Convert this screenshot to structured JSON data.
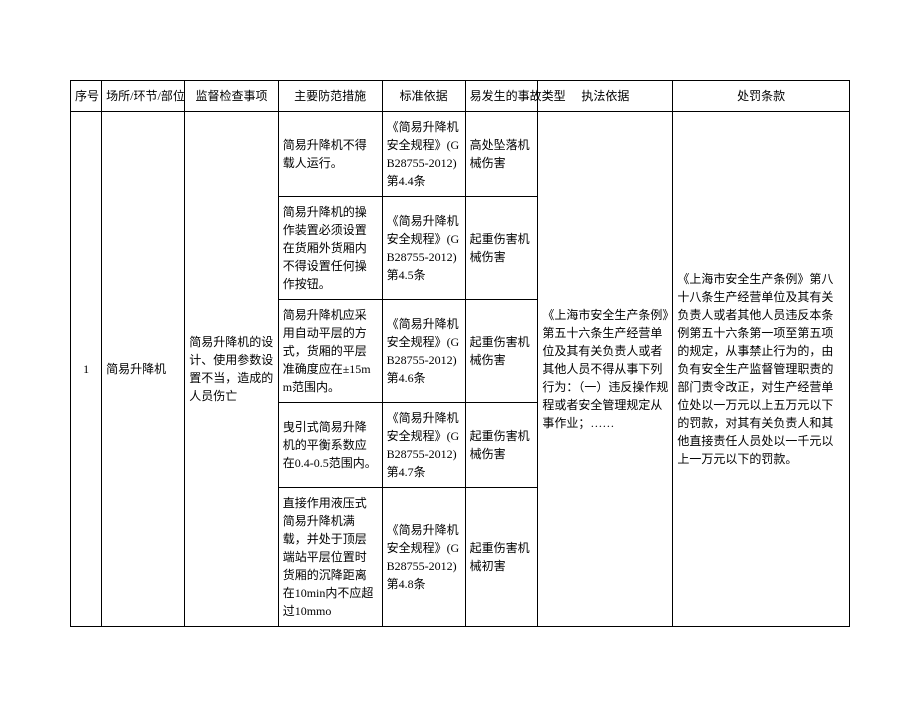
{
  "headers": {
    "seq": "序号",
    "place": "场所/环节/部位",
    "inspect": "监督检查事项",
    "measure": "主要防范措施",
    "standard": "标准依据",
    "accident": "易发生的事故类型",
    "enforce": "执法依据",
    "penalty": "处罚条款"
  },
  "row": {
    "seq": "1",
    "place": "简易升降机",
    "inspect": "简易升降机的设计、使用参数设置不当，造成的人员伤亡",
    "enforce": "《上海市安全生产条例》第五十六条生产经营单位及其有关负责人或者其他人员不得从事下列行为：（一）违反操作规程或者安全管理规定从事作业；……",
    "penalty": "《上海市安全生产条例》第八十八条生产经营单位及其有关负责人或者其他人员违反本条例第五十六条第一项至第五项的规定，从事禁止行为的，由负有安全生产监督管理职责的部门责令改正，对生产经营单位处以一万元以上五万元以下的罚款，对其有关负责人和其他直接责任人员处以一千元以上一万元以下的罚款。",
    "sub": [
      {
        "measure": "简易升降机不得载人运行。",
        "standard": "《简易升降机安全规程》(GB28755-2012)第4.4条",
        "accident": "高处坠落机械伤害"
      },
      {
        "measure": "简易升降机的操作装置必须设置在货厢外货厢内不得设置任何操作按钮。",
        "standard": "《简易升降机安全规程》(GB28755-2012)第4.5条",
        "accident": "起重伤害机械伤害"
      },
      {
        "measure": "简易升降机应采用自动平层的方式，货厢的平层准确度应在±15mm范围内。",
        "standard": "《简易升降机安全规程》(GB28755-2012)第4.6条",
        "accident": "起重伤害机械伤害"
      },
      {
        "measure": "曳引式简易升降机的平衡系数应在0.4-0.5范围内。",
        "standard": "《简易升降机安全规程》(GB28755-2012)第4.7条",
        "accident": "起重伤害机械伤害"
      },
      {
        "measure": "直接作用液压式简易升降机满载，并处于顶层端站平层位置时货厢的沉降距离在10min内不应超过10mmo",
        "standard": "《简易升降机安全规程》(GB28755-2012)第4.8条",
        "accident": "起重伤害机械初害"
      }
    ]
  }
}
